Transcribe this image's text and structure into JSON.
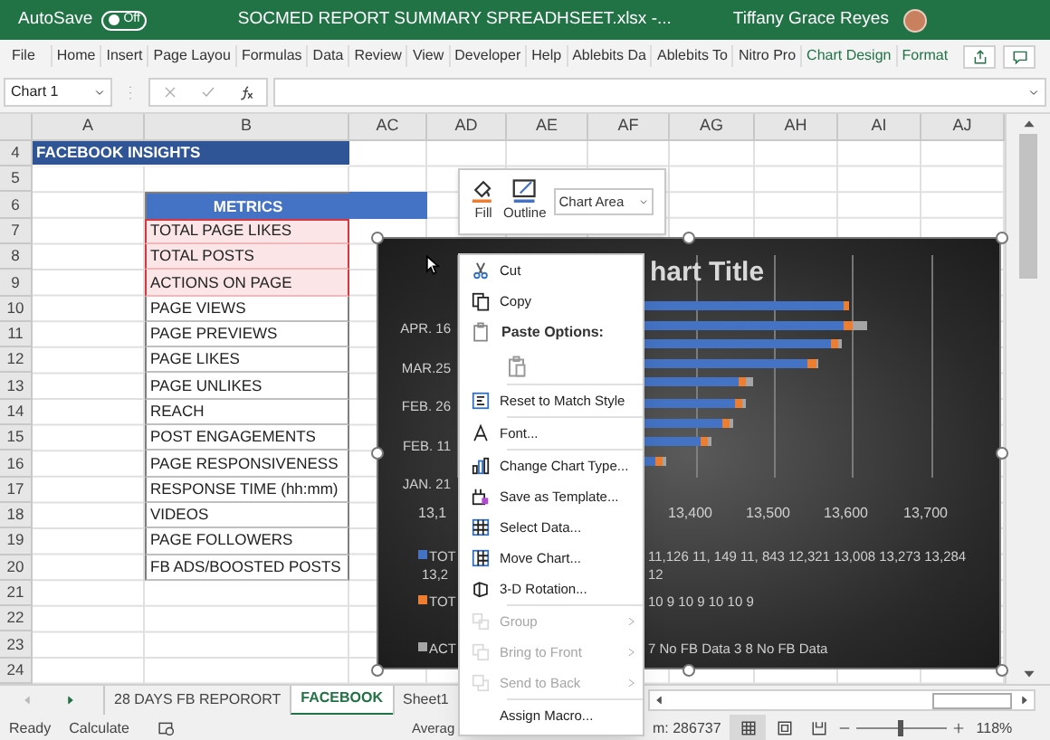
{
  "title_bar": {
    "autosave_label": "AutoSave",
    "autosave_state": "Off",
    "autosave_on": false,
    "document_title": "SOCMED REPORT SUMMARY SPREADHSEET.xlsx  -...",
    "user_name": "Tiffany Grace Reyes"
  },
  "ribbon_tabs": [
    {
      "label": "File",
      "kind": "normal"
    },
    {
      "label": "Home",
      "kind": "normal"
    },
    {
      "label": "Insert",
      "kind": "normal"
    },
    {
      "label": "Page Layou",
      "kind": "normal"
    },
    {
      "label": "Formulas",
      "kind": "normal"
    },
    {
      "label": "Data",
      "kind": "normal"
    },
    {
      "label": "Review",
      "kind": "normal"
    },
    {
      "label": "View",
      "kind": "normal"
    },
    {
      "label": "Developer",
      "kind": "normal"
    },
    {
      "label": "Help",
      "kind": "normal"
    },
    {
      "label": "Ablebits Da",
      "kind": "normal"
    },
    {
      "label": "Ablebits To",
      "kind": "normal"
    },
    {
      "label": "Nitro Pro",
      "kind": "normal"
    },
    {
      "label": "Chart Design",
      "kind": "contextual"
    },
    {
      "label": "Format",
      "kind": "contextual"
    }
  ],
  "name_box": "Chart 1",
  "column_headers": [
    "A",
    "B",
    "AC",
    "AD",
    "AE",
    "AF",
    "AG",
    "AH",
    "AI",
    "AJ"
  ],
  "rows": [
    {
      "number": "4",
      "kind": "section",
      "text": "FACEBOOK INSIGHTS"
    },
    {
      "number": "5",
      "kind": "blank"
    },
    {
      "number": "6",
      "kind": "header",
      "text": "METRICS"
    },
    {
      "number": "7",
      "kind": "metric",
      "text": "TOTAL PAGE LIKES",
      "selected": true
    },
    {
      "number": "8",
      "kind": "metric",
      "text": "TOTAL POSTS",
      "selected": true
    },
    {
      "number": "9",
      "kind": "metric",
      "text": "ACTIONS ON PAGE",
      "selected": true
    },
    {
      "number": "10",
      "kind": "metric",
      "text": "PAGE VIEWS",
      "selected": false
    },
    {
      "number": "11",
      "kind": "metric",
      "text": "PAGE PREVIEWS",
      "selected": false
    },
    {
      "number": "12",
      "kind": "metric",
      "text": "PAGE LIKES",
      "selected": false
    },
    {
      "number": "13",
      "kind": "metric",
      "text": "PAGE UNLIKES",
      "selected": false
    },
    {
      "number": "14",
      "kind": "metric",
      "text": "REACH",
      "selected": false
    },
    {
      "number": "15",
      "kind": "metric",
      "text": "POST ENGAGEMENTS",
      "selected": false
    },
    {
      "number": "16",
      "kind": "metric",
      "text": "PAGE RESPONSIVENESS",
      "selected": false
    },
    {
      "number": "17",
      "kind": "metric",
      "text": "RESPONSE TIME (hh:mm)",
      "selected": false
    },
    {
      "number": "18",
      "kind": "metric",
      "text": "VIDEOS",
      "selected": false
    },
    {
      "number": "19",
      "kind": "metric",
      "text": "PAGE FOLLOWERS",
      "selected": false
    },
    {
      "number": "20",
      "kind": "metric",
      "text": "FB ADS/BOOSTED POSTS",
      "selected": false
    },
    {
      "number": "21",
      "kind": "blank"
    },
    {
      "number": "22",
      "kind": "blank"
    },
    {
      "number": "23",
      "kind": "blank"
    },
    {
      "number": "24",
      "kind": "blank"
    }
  ],
  "mini_toolbar": {
    "fill_label": "Fill",
    "outline_label": "Outline",
    "chart_element": "Chart Area"
  },
  "chart": {
    "title": "hart Title",
    "category_labels": [
      "APR. 16",
      "MAR.25",
      "FEB. 26",
      "FEB. 11",
      "JAN. 21"
    ],
    "axis_labels": [
      "13,1",
      "13,400",
      "13,500",
      "13,600",
      "13,700"
    ],
    "legend": [
      {
        "color": "#4472c4",
        "name": "TOT",
        "values": "11,126 11, 149 11, 843 12,321 13,008 13,273 13,284",
        "wrap_name": "13,2",
        "wrap_values": "12"
      },
      {
        "color": "#ed7d31",
        "name": "TOT",
        "values": "10 9 10 9 10 10 9"
      },
      {
        "color": "#a5a5a5",
        "name": "ACT",
        "values": "7 No FB Data 3 8 No FB Data"
      }
    ]
  },
  "context_menu": [
    {
      "kind": "item",
      "label": "Cut",
      "disabled": false,
      "submenu": false
    },
    {
      "kind": "item",
      "label": "Copy",
      "disabled": false,
      "submenu": false
    },
    {
      "kind": "heading",
      "label": "Paste Options:"
    },
    {
      "kind": "paste"
    },
    {
      "kind": "separator"
    },
    {
      "kind": "item",
      "label": "Reset to Match Style",
      "disabled": false,
      "submenu": false
    },
    {
      "kind": "separator"
    },
    {
      "kind": "item",
      "label": "Font...",
      "disabled": false,
      "submenu": false
    },
    {
      "kind": "separator"
    },
    {
      "kind": "item",
      "label": "Change Chart Type...",
      "disabled": false,
      "submenu": false
    },
    {
      "kind": "item",
      "label": "Save as Template...",
      "disabled": false,
      "submenu": false
    },
    {
      "kind": "item",
      "label": "Select Data...",
      "disabled": false,
      "submenu": false
    },
    {
      "kind": "item",
      "label": "Move Chart...",
      "disabled": false,
      "submenu": false
    },
    {
      "kind": "item",
      "label": "3-D Rotation...",
      "disabled": false,
      "submenu": false
    },
    {
      "kind": "separator"
    },
    {
      "kind": "item",
      "label": "Group",
      "disabled": true,
      "submenu": true
    },
    {
      "kind": "item",
      "label": "Bring to Front",
      "disabled": true,
      "submenu": true
    },
    {
      "kind": "item",
      "label": "Send to Back",
      "disabled": true,
      "submenu": true
    },
    {
      "kind": "separator"
    },
    {
      "kind": "item",
      "label": "Assign Macro...",
      "disabled": false,
      "submenu": false
    }
  ],
  "sheet_tabs": [
    {
      "label": "28 DAYS FB REPORORT",
      "selected": false
    },
    {
      "label": "FACEBOOK",
      "selected": true
    },
    {
      "label": "Sheet1",
      "selected": false
    }
  ],
  "status_bar": {
    "mode": "Ready",
    "calculate": "Calculate",
    "average": "Averag",
    "sum": "m: 286737",
    "zoom": "118%",
    "zoom_slider": {
      "level": 0.48
    }
  }
}
